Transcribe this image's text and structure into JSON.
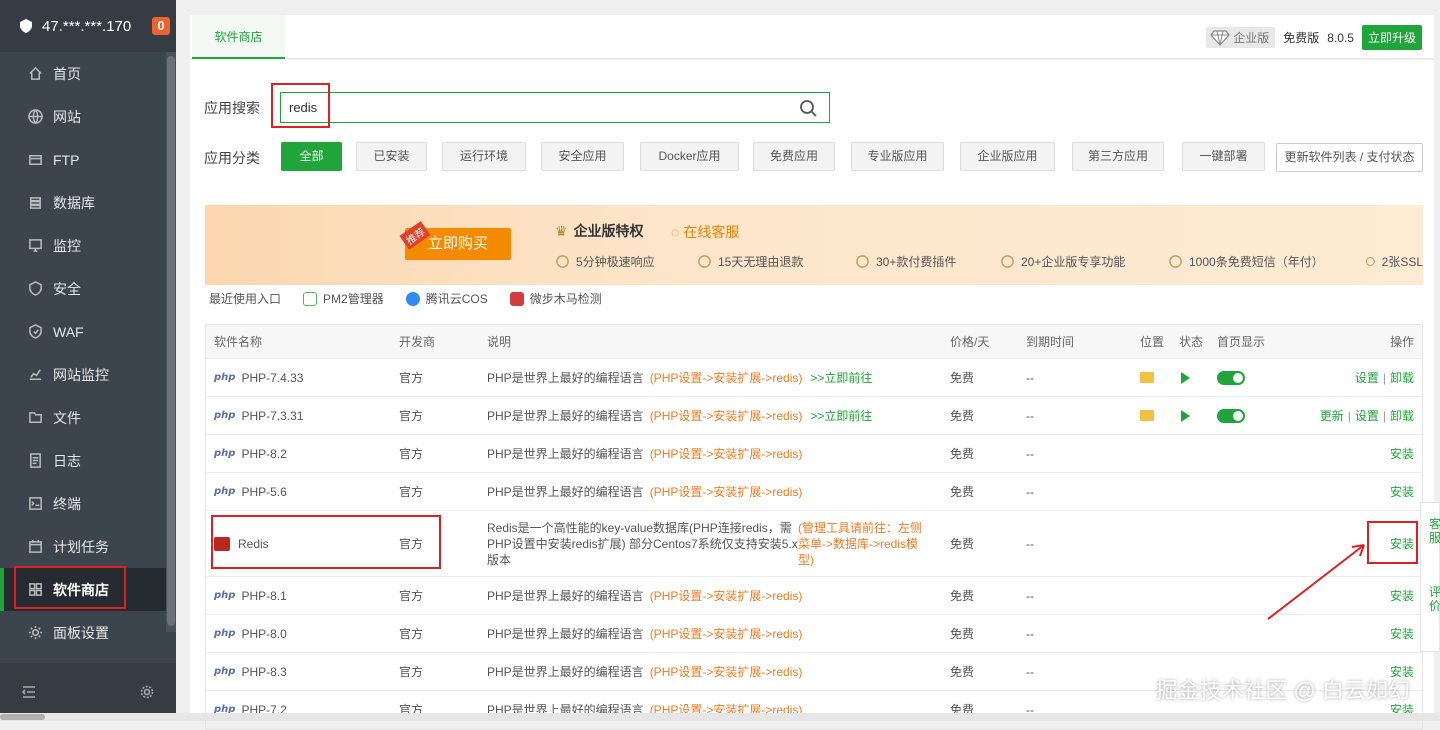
{
  "sidebar": {
    "server": "47.***.***.170",
    "badge": "0",
    "items": [
      {
        "label": "首页",
        "icon": "home-icon"
      },
      {
        "label": "网站",
        "icon": "globe-icon"
      },
      {
        "label": "FTP",
        "icon": "ftp-icon"
      },
      {
        "label": "数据库",
        "icon": "database-icon"
      },
      {
        "label": "监控",
        "icon": "monitor-icon"
      },
      {
        "label": "安全",
        "icon": "shield-icon"
      },
      {
        "label": "WAF",
        "icon": "waf-icon"
      },
      {
        "label": "网站监控",
        "icon": "chart-icon"
      },
      {
        "label": "文件",
        "icon": "folder-icon"
      },
      {
        "label": "日志",
        "icon": "log-icon"
      },
      {
        "label": "终端",
        "icon": "terminal-icon"
      },
      {
        "label": "计划任务",
        "icon": "calendar-icon"
      },
      {
        "label": "软件商店",
        "icon": "grid-icon"
      },
      {
        "label": "面板设置",
        "icon": "gear-icon"
      }
    ]
  },
  "topbar": {
    "tab": "软件商店",
    "enterprise": "企业版",
    "free": "免费版",
    "version": "8.0.5",
    "upgrade": "立即升级"
  },
  "search": {
    "label": "应用搜索",
    "value": "redis"
  },
  "categories": {
    "label": "应用分类",
    "items": [
      "全部",
      "已安装",
      "运行环境",
      "安全应用",
      "Docker应用",
      "免费应用",
      "专业版应用",
      "企业版应用",
      "第三方应用",
      "一键部署"
    ],
    "refresh": "更新软件列表 / 支付状态"
  },
  "banner": {
    "tag": "推荐",
    "buy": "立即购买",
    "title": "企业版特权",
    "service": "在线客服",
    "features": [
      "5分钟极速响应",
      "15天无理由退款",
      "30+款付费插件",
      "20+企业版专享功能",
      "1000条免费短信（年付）",
      "2张SSL"
    ]
  },
  "recent": {
    "label": "最近使用入口",
    "items": [
      "PM2管理器",
      "腾讯云COS",
      "微步木马检测"
    ]
  },
  "table": {
    "headers": [
      "软件名称",
      "开发商",
      "说明",
      "价格/天",
      "到期时间",
      "位置",
      "状态",
      "首页显示",
      "操作"
    ],
    "desc_php": "PHP是世界上最好的编程语言",
    "hint_php": "(PHP设置->安装扩展->redis)",
    "goto": ">>立即前往",
    "rows": [
      {
        "name": "PHP-7.4.33",
        "vendor": "官方",
        "price": "免费",
        "expire": "--",
        "installed": true,
        "ops": [
          "设置",
          "卸载"
        ]
      },
      {
        "name": "PHP-7.3.31",
        "vendor": "官方",
        "price": "免费",
        "expire": "--",
        "installed": true,
        "ops": [
          "更新",
          "设置",
          "卸载"
        ]
      },
      {
        "name": "PHP-8.2",
        "vendor": "官方",
        "price": "免费",
        "expire": "--",
        "ops": [
          "安装"
        ]
      },
      {
        "name": "PHP-5.6",
        "vendor": "官方",
        "price": "免费",
        "expire": "--",
        "ops": [
          "安装"
        ]
      },
      {
        "name": "Redis",
        "vendor": "官方",
        "price": "免费",
        "expire": "--",
        "ops": [
          "安装"
        ],
        "desc": "Redis是一个高性能的key-value数据库(PHP连接redis，需PHP设置中安装redis扩展) 部分Centos7系统仅支持安装5.x版本",
        "hint": "(管理工具请前往：左侧菜单->数据库->redis模型)"
      },
      {
        "name": "PHP-8.1",
        "vendor": "官方",
        "price": "免费",
        "expire": "--",
        "ops": [
          "安装"
        ]
      },
      {
        "name": "PHP-8.0",
        "vendor": "官方",
        "price": "免费",
        "expire": "--",
        "ops": [
          "安装"
        ]
      },
      {
        "name": "PHP-8.3",
        "vendor": "官方",
        "price": "免费",
        "expire": "--",
        "ops": [
          "安装"
        ]
      },
      {
        "name": "PHP-7.2",
        "vendor": "官方",
        "price": "免费",
        "expire": "--",
        "ops": [
          "安装"
        ]
      }
    ]
  },
  "float": {
    "service": "客服",
    "review": "评价"
  },
  "watermark": "掘金技术社区 @ 白云如幻"
}
